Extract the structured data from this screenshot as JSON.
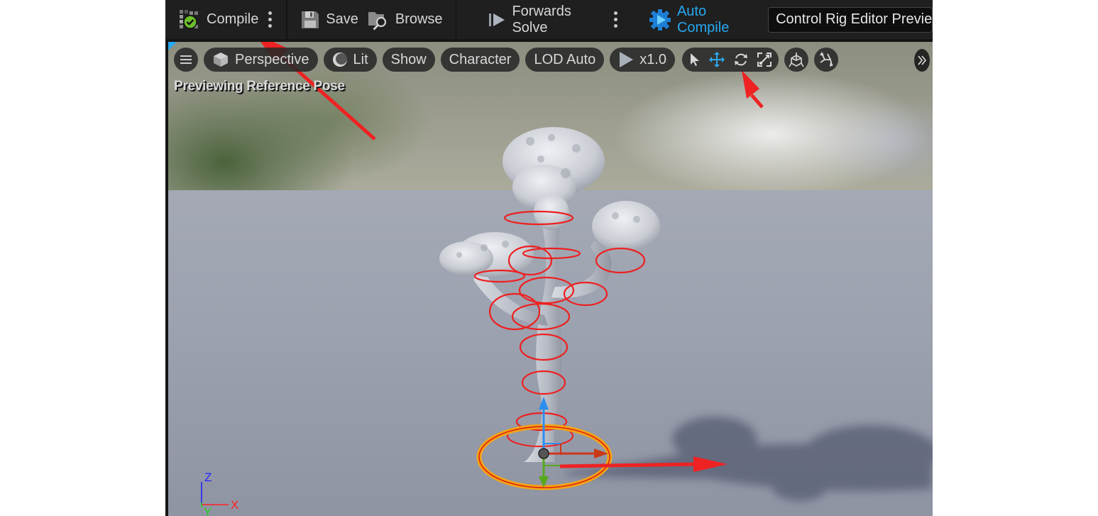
{
  "toolbar": {
    "compile_label": "Compile",
    "save_label": "Save",
    "browse_label": "Browse",
    "solve_label": "Forwards Solve",
    "auto_compile_label": "Auto Compile",
    "preview_scene_value": "Control Rig Editor Preview",
    "icons": {
      "compile": "compile-success-icon",
      "save": "floppy-disk-icon",
      "browse": "folder-search-icon",
      "solve": "play-step-icon",
      "auto_compile": "gear-play-icon"
    },
    "colors": {
      "compile_ok": "#6bbf2a",
      "auto_compile": "#27a8f0"
    }
  },
  "viewport": {
    "menu_icon": "hamburger-icon",
    "perspective_label": "Perspective",
    "lit_label": "Lit",
    "show_label": "Show",
    "character_label": "Character",
    "lod_label": "LOD Auto",
    "speed_label": "x1.0",
    "transform_tools": [
      "select-icon",
      "translate-icon",
      "rotate-icon",
      "scale-icon"
    ],
    "active_tool": "translate-icon",
    "extra_tools": [
      "control-rig-bone-icon",
      "control-rig-tweak-icon"
    ],
    "overflow_icon": "chevron-double-right-icon",
    "status_text": "Previewing Reference Pose",
    "axis_labels": {
      "z": "Z",
      "x": "X",
      "y": "Y"
    },
    "accent_color": "#27a8f0"
  },
  "annotations": {
    "arrows": [
      "arrow-to-compile",
      "arrow-to-translate-tool",
      "arrow-along-x-axis"
    ],
    "color": "#ee2222"
  }
}
